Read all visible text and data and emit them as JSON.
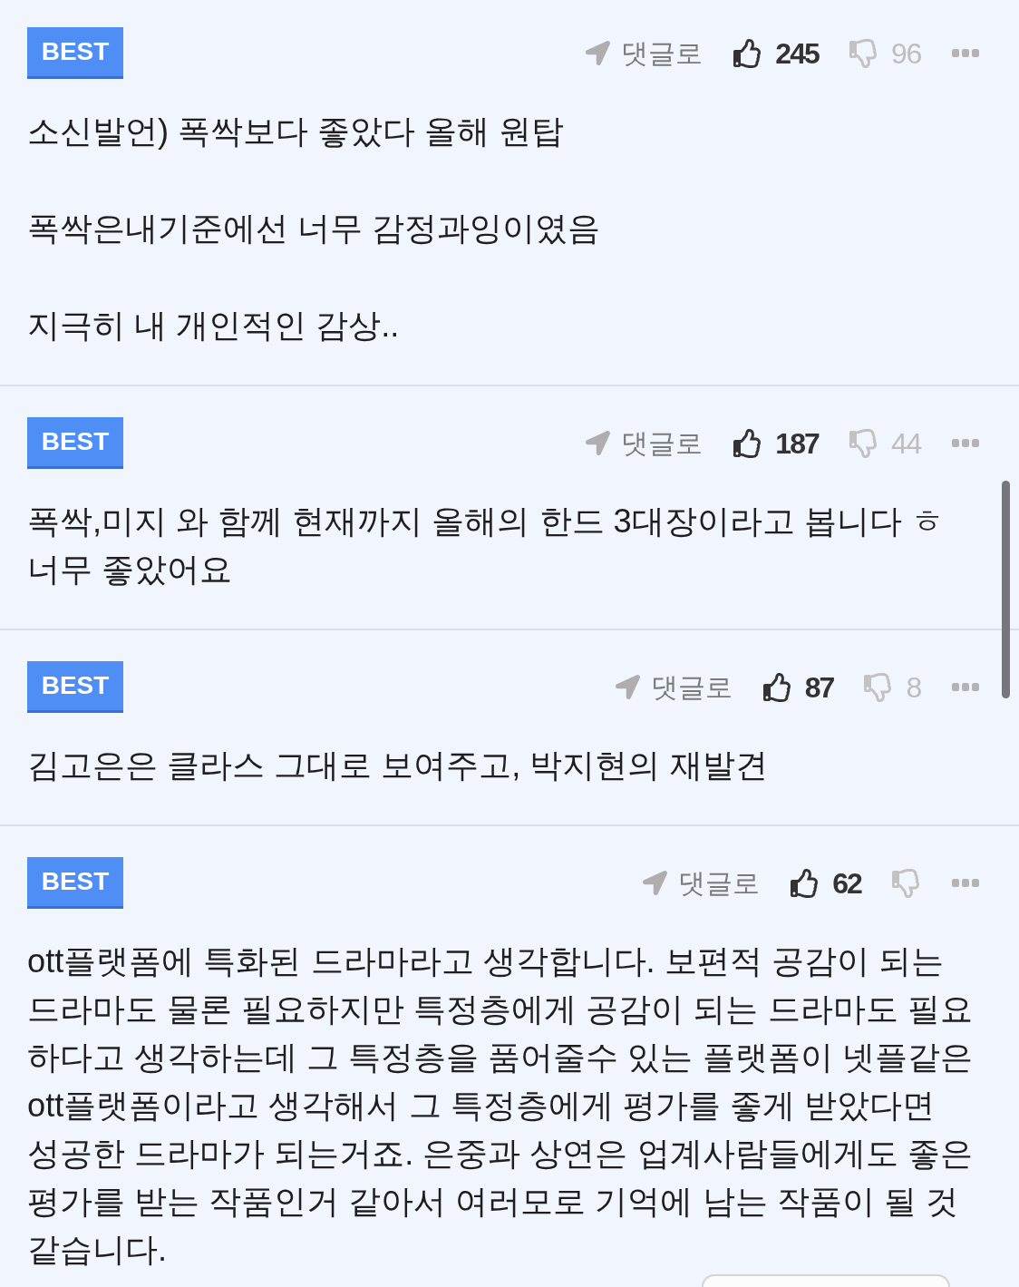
{
  "comments": [
    {
      "badge": "BEST",
      "reply_label": "댓글로",
      "likes": "245",
      "dislikes": "96",
      "paragraphs": [
        "소신발언) 폭싹보다 좋았다 올해 원탑",
        "폭싹은내기준에선 너무 감정과잉이였음",
        "지극히 내 개인적인 감상.."
      ]
    },
    {
      "badge": "BEST",
      "reply_label": "댓글로",
      "likes": "187",
      "dislikes": "44",
      "paragraphs": [
        "폭싹,미지 와 함께 현재까지 올해의 한드 3대장이라고 봅니다 ㅎ 너무 좋았어요"
      ]
    },
    {
      "badge": "BEST",
      "reply_label": "댓글로",
      "likes": "87",
      "dislikes": "8",
      "paragraphs": [
        "김고은은 클라스 그대로 보여주고, 박지현의 재발견"
      ]
    },
    {
      "badge": "BEST",
      "reply_label": "댓글로",
      "likes": "62",
      "paragraphs": [
        "ott플랫폼에 특화된 드라마라고 생각합니다. 보편적 공감이 되는 드라마도 물론 필요하지만 특정층에게 공감이 되는 드라마도 필요하다고 생각하는데 그 특정층을 품어줄수 있는 플랫폼이 넷플같은 ott플랫폼이라고 생각해서 그 특정층에게 평가를 좋게 받았다면 성공한 드라마가 되는거죠. 은중과 상연은 업계사람들에게도 좋은 평가를 받는 작품인거 같아서 여러모로 기억에 남는 작품이 될 것 같습니다."
      ]
    }
  ]
}
